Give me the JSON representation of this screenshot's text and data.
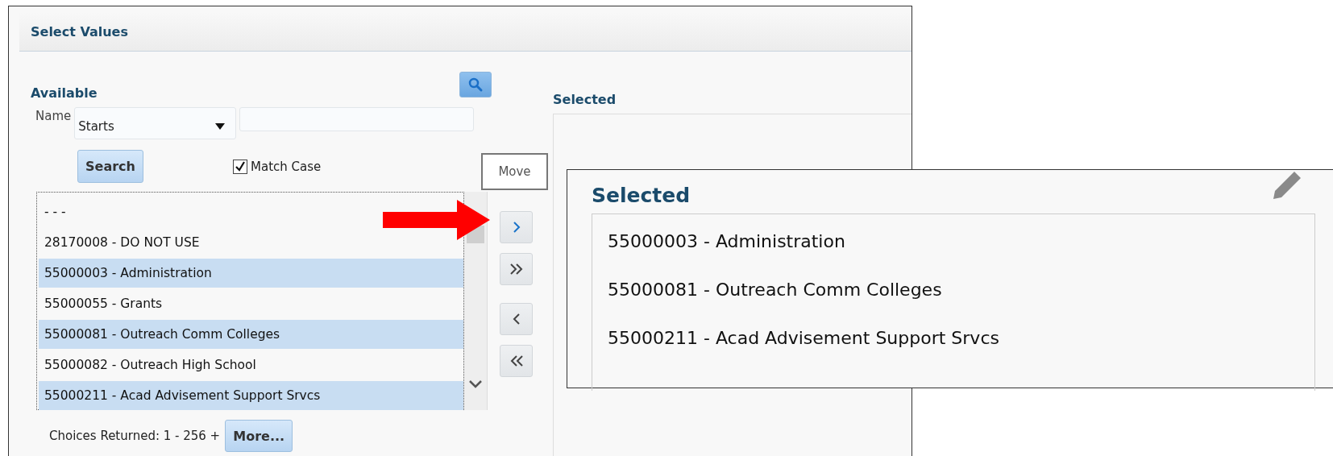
{
  "dialog": {
    "title": "Select Values"
  },
  "available": {
    "label": "Available",
    "filter_label": "Name",
    "operator": "Starts",
    "search_button": "Search",
    "match_case": {
      "label": "Match Case",
      "checked": true
    },
    "items": [
      {
        "text": "- - -",
        "selected": false
      },
      {
        "text": "28170008 - DO NOT USE",
        "selected": false
      },
      {
        "text": "55000003 - Administration",
        "selected": true
      },
      {
        "text": "55000055 - Grants",
        "selected": false
      },
      {
        "text": "55000081 - Outreach Comm Colleges",
        "selected": true
      },
      {
        "text": "55000082 - Outreach High School",
        "selected": false
      },
      {
        "text": "55000211 - Acad Advisement Support Srvcs",
        "selected": true
      }
    ],
    "choices_returned": "Choices Returned: 1 - 256 +",
    "more_button": "More..."
  },
  "tooltip": "Move",
  "selected": {
    "label": "Selected"
  },
  "callout": {
    "title": "Selected",
    "items": [
      {
        "text": "55000003 - Administration"
      },
      {
        "text": "55000081 - Outreach Comm Colleges"
      },
      {
        "text": "55000211 - Acad Advisement Support Srvcs"
      }
    ]
  }
}
